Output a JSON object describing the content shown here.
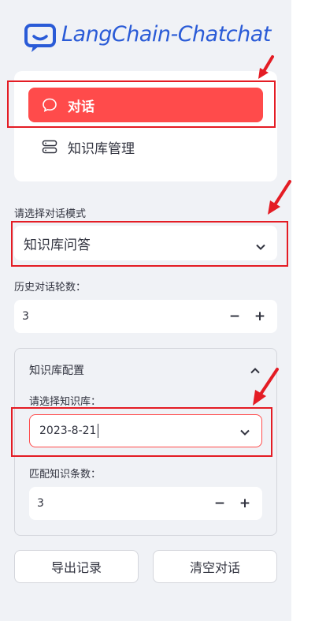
{
  "app": {
    "logo_text": "LangChain-Chatchat",
    "logo_icon": "chat-bubble-icon",
    "brand_color": "#2a5bd7",
    "accent_color": "#ff4b4b"
  },
  "menu": {
    "items": [
      {
        "label": "对话",
        "icon": "chat-bubble-icon",
        "active": true
      },
      {
        "label": "知识库管理",
        "icon": "database-icon",
        "active": false
      }
    ]
  },
  "dialogue_mode": {
    "label": "请选择对话模式",
    "selected": "知识库问答"
  },
  "history_turns": {
    "label": "历史对话轮数：",
    "value": "3",
    "minus": "−",
    "plus": "+"
  },
  "kb_config": {
    "title": "知识库配置",
    "kb_select_label": "请选择知识库：",
    "kb_selected": "2023-8-21",
    "match_count_label": "匹配知识条数：",
    "match_count_value": "3",
    "minus": "−",
    "plus": "+"
  },
  "actions": {
    "export_label": "导出记录",
    "clear_label": "清空对话"
  },
  "annotation_color": "#e41c24"
}
